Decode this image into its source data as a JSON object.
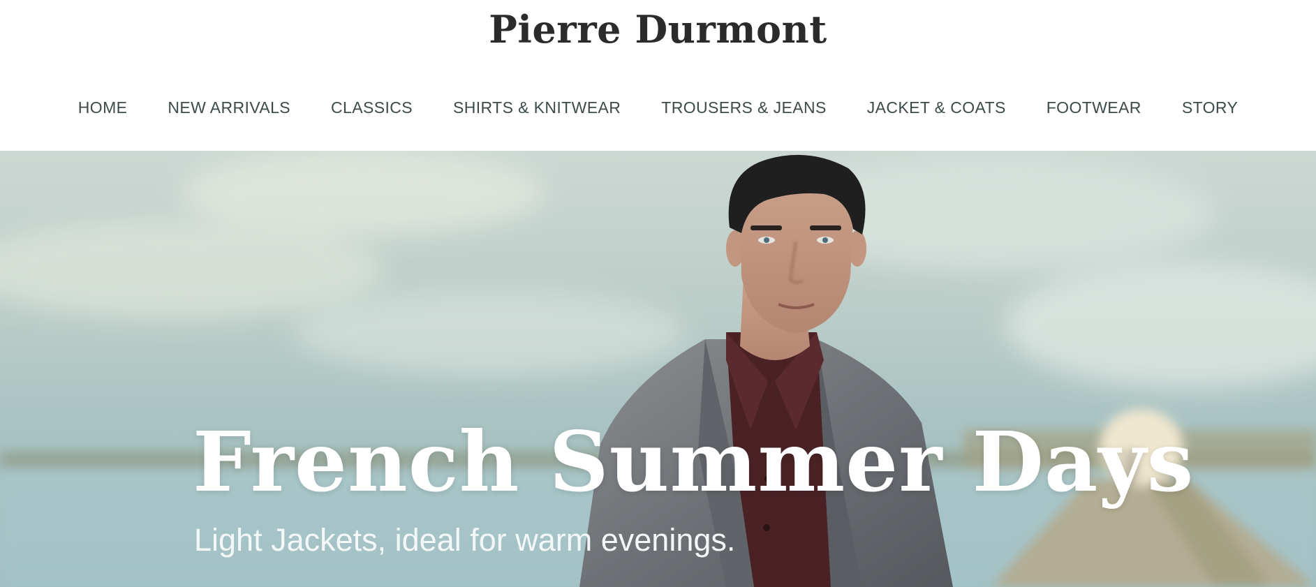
{
  "brand": {
    "name": "Pierre Durmont"
  },
  "nav": {
    "items": [
      {
        "label": "HOME"
      },
      {
        "label": "NEW ARRIVALS"
      },
      {
        "label": "CLASSICS"
      },
      {
        "label": "SHIRTS & KNITWEAR"
      },
      {
        "label": "TROUSERS & JEANS"
      },
      {
        "label": "JACKET & COATS"
      },
      {
        "label": "FOOTWEAR"
      },
      {
        "label": "STORY"
      }
    ]
  },
  "hero": {
    "title": "French Summer Days",
    "subtitle": "Light Jackets, ideal for warm evenings."
  },
  "colors": {
    "brand_text": "#2b2b2b",
    "nav_text": "#3d4a4a",
    "hero_text": "#ffffff"
  }
}
